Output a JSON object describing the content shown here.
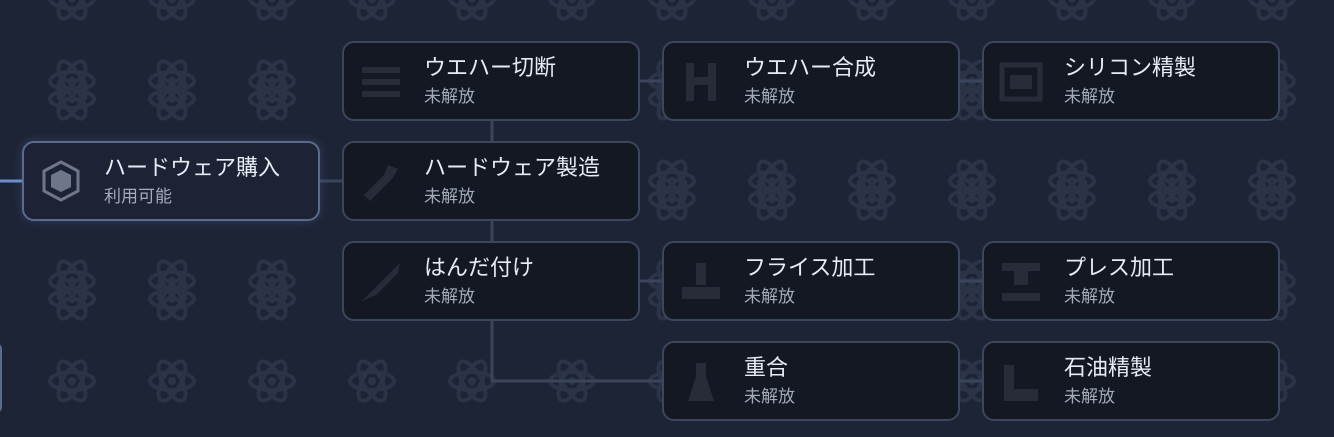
{
  "colors": {
    "background": "#1d2436",
    "node_background": "#141823",
    "node_border": "#3c465c",
    "available_border": "#5b6b8c",
    "connector": "#3a455b",
    "active_connector": "#6e8fc6"
  },
  "nodes": {
    "hardware_purchase": {
      "title": "ハードウェア購入",
      "status": "利用可能",
      "icon": "cube-icon"
    },
    "wafer_cutting": {
      "title": "ウエハー切断",
      "status": "未解放",
      "icon": "saw-icon"
    },
    "wafer_synthesis": {
      "title": "ウエハー合成",
      "status": "未解放",
      "icon": "press-icon"
    },
    "silicon_refining": {
      "title": "シリコン精製",
      "status": "未解放",
      "icon": "furnace-icon"
    },
    "hardware_manufacturing": {
      "title": "ハードウェア製造",
      "status": "未解放",
      "icon": "wrench-icon"
    },
    "soldering": {
      "title": "はんだ付け",
      "status": "未解放",
      "icon": "soldering-iron-icon"
    },
    "milling": {
      "title": "フライス加工",
      "status": "未解放",
      "icon": "milling-machine-icon"
    },
    "press_working": {
      "title": "プレス加工",
      "status": "未解放",
      "icon": "press-icon"
    },
    "polymerization": {
      "title": "重合",
      "status": "未解放",
      "icon": "flask-icon"
    },
    "oil_refining": {
      "title": "石油精製",
      "status": "未解放",
      "icon": "refinery-icon"
    }
  }
}
